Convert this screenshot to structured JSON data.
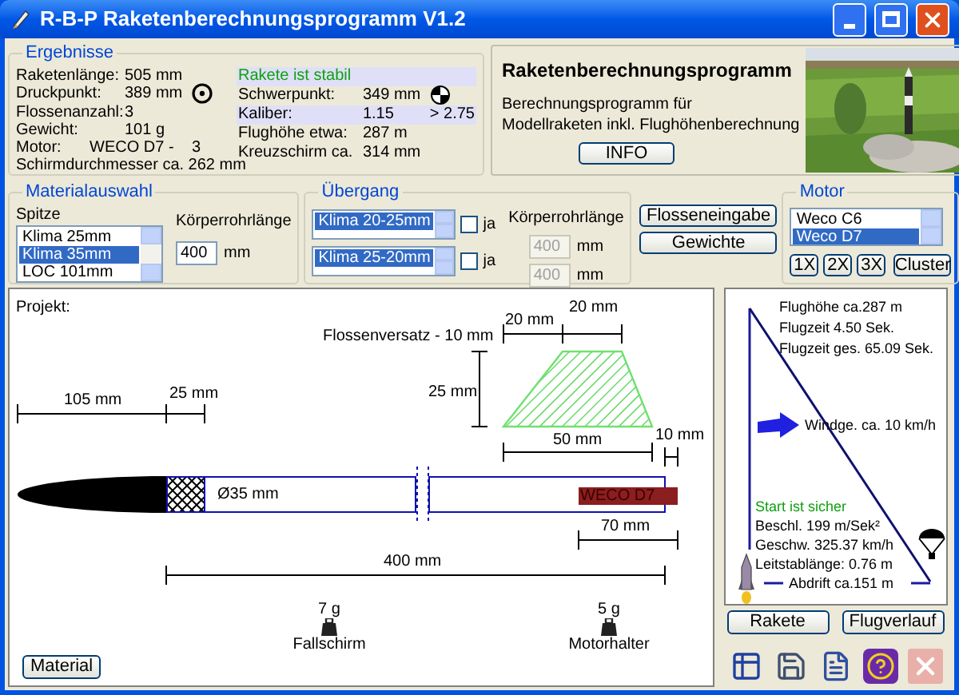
{
  "window": {
    "title": "R-B-P Raketenberechnungsprogramm V1.2"
  },
  "results": {
    "title": "Ergebnisse",
    "left": [
      {
        "label": "Raketenlänge:",
        "value": "505 mm"
      },
      {
        "label": "Druckpunkt:",
        "value": "389 mm"
      },
      {
        "label": "Flossenanzahl:",
        "value": "3"
      },
      {
        "label": "Gewicht:",
        "value": "101 g"
      },
      {
        "label": "Motor:",
        "value": "WECO D7 -",
        "value_2": "3"
      },
      {
        "label": "Schirmdurchmesser ca. 262 mm"
      }
    ],
    "right": [
      {
        "kind": "status",
        "label": "Rakete ist stabil",
        "highlighted": true
      },
      {
        "kind": "value",
        "label": "Schwerpunkt:",
        "value": "349 mm",
        "highlighted": false
      },
      {
        "kind": "value",
        "label": "Kaliber:",
        "value": "1.15",
        "value_2": "> 2.75",
        "highlighted": true
      },
      {
        "kind": "value",
        "label": "Flughöhe etwa:",
        "value": "287 m",
        "highlighted": false
      },
      {
        "kind": "value",
        "label": "Kreuzschirm ca.",
        "value": "314 mm",
        "highlighted": false
      }
    ]
  },
  "info": {
    "title": "Raketenberechnungsprogramm",
    "text": [
      "Berechnungsprogramm für",
      "Modellraketen inkl. Flughöhenberechnung"
    ],
    "button": "INFO"
  },
  "material": {
    "title": "Materialauswahl",
    "nose_label": "Spitze",
    "nose_options": [
      {
        "label": "Klima 25mm",
        "selected": false
      },
      {
        "label": "Klima 35mm",
        "selected": true
      },
      {
        "label": "LOC 101mm",
        "selected": false
      }
    ],
    "tube_label": "Körperrohrlänge",
    "tube_value": "400",
    "tube_unit": "mm"
  },
  "transition": {
    "title": "Übergang",
    "length_label": "Körperrohrlänge",
    "rows": [
      {
        "options": [
          {
            "label": "Klima 20-25mm",
            "selected": true
          }
        ],
        "checkbox_label": "ja",
        "checked": false,
        "length": "400",
        "unit": "mm",
        "disabled": true
      },
      {
        "options": [
          {
            "label": "Klima 25-20mm",
            "selected": true
          }
        ],
        "checkbox_label": "ja",
        "checked": false,
        "length": "400",
        "unit": "mm",
        "disabled": true
      }
    ]
  },
  "buttons": [
    "Flosseneingabe",
    "Gewichte"
  ],
  "motor": {
    "title": "Motor",
    "options": [
      {
        "label": "Weco C6",
        "selected": false
      },
      {
        "label": "Weco D7",
        "selected": true
      }
    ],
    "multipliers": [
      {
        "label": "1X",
        "selected": false
      },
      {
        "label": "2X",
        "selected": false
      },
      {
        "label": "3X",
        "selected": false
      }
    ],
    "cluster_button": "Cluster"
  },
  "diagram": {
    "project_label": "Projekt:",
    "fin_offset": "Flossenversatz - 10 mm",
    "nose_length": "105 mm",
    "shoulder_length": "25 mm",
    "fin_height": "25 mm",
    "fin_sweep": "20 mm",
    "fin_tip": "20 mm",
    "fin_root": "50 mm",
    "fin_gap": "10 mm",
    "diameter": "Ø35 mm",
    "motor": "WECO D7",
    "motor_length": "70 mm",
    "tube_length": "400 mm",
    "weights": [
      {
        "mass": "7 g",
        "label": "Fallschirm"
      },
      {
        "mass": "5 g",
        "label": "Motorhalter"
      }
    ],
    "button": "Material"
  },
  "flight": {
    "altitude": "Flughöhe ca.287 m",
    "flight_time": "Flugzeit 4.50 Sek.",
    "total_time": "Flugzeit ges. 65.09 Sek.",
    "wind": "Windge. ca. 10 km/h",
    "safe": true,
    "status": "Start ist sicher",
    "acceleration": "Beschl. 199 m/Sek²",
    "speed": "Geschw. 325.37 km/h",
    "rod": "Leitstablänge: 0.76 m",
    "drift": "Abdrift ca.151 m"
  },
  "flight_buttons": [
    "Rakete",
    "Flugverlauf"
  ]
}
